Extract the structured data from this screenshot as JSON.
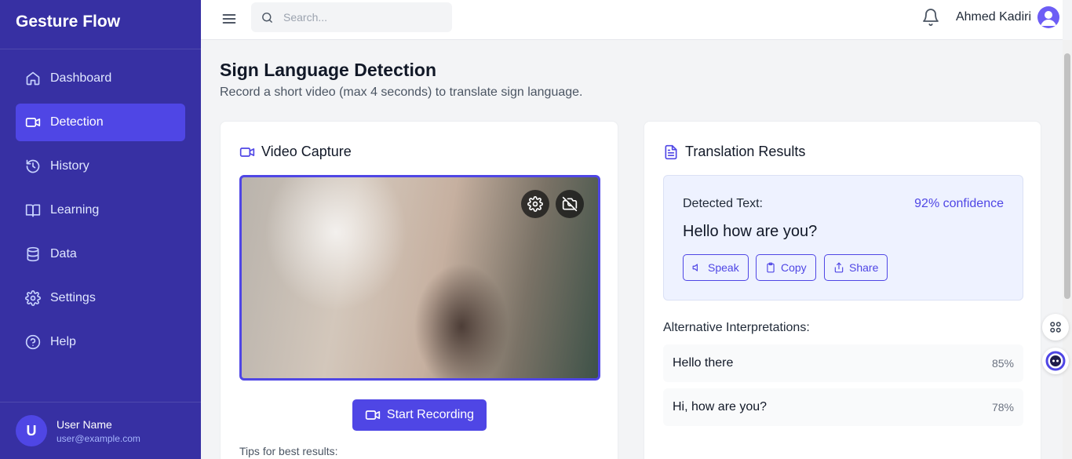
{
  "app": {
    "brand": "Gesture Flow"
  },
  "sidebar": {
    "items": [
      {
        "label": "Dashboard",
        "icon": "home-icon",
        "active": false
      },
      {
        "label": "Detection",
        "icon": "video-camera-icon",
        "active": true
      },
      {
        "label": "History",
        "icon": "history-icon",
        "active": false
      },
      {
        "label": "Learning",
        "icon": "book-open-icon",
        "active": false
      },
      {
        "label": "Data",
        "icon": "database-icon",
        "active": false
      },
      {
        "label": "Settings",
        "icon": "gear-icon",
        "active": false
      },
      {
        "label": "Help",
        "icon": "help-circle-icon",
        "active": false
      }
    ],
    "user": {
      "initial": "U",
      "name": "User Name",
      "email": "user@example.com"
    }
  },
  "topbar": {
    "search_placeholder": "Search...",
    "user_name": "Ahmed Kadiri"
  },
  "page": {
    "title": "Sign Language Detection",
    "subtitle": "Record a short video (max 4 seconds) to translate sign language."
  },
  "video_capture": {
    "title": "Video Capture",
    "record_label": "Start Recording",
    "tips_label": "Tips for best results:"
  },
  "results": {
    "title": "Translation Results",
    "detected_label": "Detected Text:",
    "confidence": "92% confidence",
    "detected_text": "Hello how are you?",
    "actions": {
      "speak": "Speak",
      "copy": "Copy",
      "share": "Share"
    },
    "alternatives_label": "Alternative Interpretations:",
    "alternatives": [
      {
        "text": "Hello there",
        "score": "85%"
      },
      {
        "text": "Hi, how are you?",
        "score": "78%"
      }
    ]
  },
  "colors": {
    "sidebar": "#3730a3",
    "accent": "#4f46e5",
    "active_item": "#4f46e5"
  }
}
